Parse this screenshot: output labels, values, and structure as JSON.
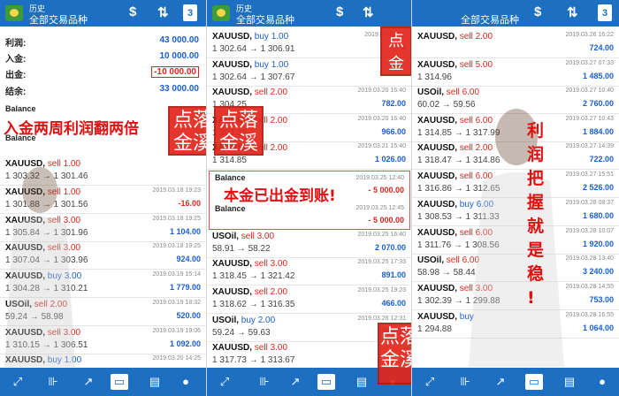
{
  "header": {
    "subtitle": "历史",
    "title": "全部交易品种",
    "calendar_day": "3"
  },
  "summary": [
    {
      "label": "利润:",
      "value": "43 000.00",
      "neg": false
    },
    {
      "label": "入金:",
      "value": "10 000.00",
      "neg": false
    },
    {
      "label": "出金:",
      "value": "-10 000.00",
      "neg": true
    },
    {
      "label": "结余:",
      "value": "33 000.00",
      "neg": false
    }
  ],
  "overlays": {
    "headline": "入金两周利润翻两倍",
    "principal": "本金已出金到账!",
    "side_text": [
      "利",
      "润",
      "把",
      "握",
      "就",
      "是",
      "稳",
      "!"
    ],
    "seal": [
      "点",
      "落",
      "金",
      "溪"
    ]
  },
  "panel1": {
    "balance1": "Balance",
    "balance2": "Balance",
    "trades": [
      {
        "symbol": "XAUUSD,",
        "side": "sell",
        "lot": "1.00",
        "price": "1 303.32 → 1 301.46",
        "date": "",
        "pl": ""
      },
      {
        "symbol": "XAUUSD,",
        "side": "sell",
        "lot": "1.00",
        "price": "1 301.88 → 1 301.56",
        "date": "2019.03.18 19:23",
        "pl": "-16.00"
      },
      {
        "symbol": "XAUUSD,",
        "side": "sell",
        "lot": "3.00",
        "price": "1 305.84 → 1 301.96",
        "date": "2019.03.18 19:25",
        "pl": "1 104.00"
      },
      {
        "symbol": "XAUUSD,",
        "side": "sell",
        "lot": "3.00",
        "price": "1 307.04 → 1 303.96",
        "date": "2019.03.18 19:25",
        "pl": "924.00"
      },
      {
        "symbol": "XAUUSD,",
        "side": "buy",
        "lot": "3.00",
        "price": "1 304.28 → 1 310.21",
        "date": "2019.03.19 15:14",
        "pl": "1 779.00"
      },
      {
        "symbol": "USOil,",
        "side": "sell",
        "lot": "2.00",
        "price": "59.24 → 58.98",
        "date": "2019.03.19 18:32",
        "pl": "520.00"
      },
      {
        "symbol": "XAUUSD,",
        "side": "sell",
        "lot": "3.00",
        "price": "1 310.15 → 1 306.51",
        "date": "2019.03.19 19:06",
        "pl": "1 092.00"
      },
      {
        "symbol": "XAUUSD,",
        "side": "buy",
        "lot": "1.00",
        "price": "",
        "date": "2019.03.20 14:25",
        "pl": ""
      }
    ]
  },
  "panel2": {
    "callout_balance1": "Balance",
    "callout_balance2": "Balance",
    "callout_date1": "2019.03.25 12:40",
    "callout_pl1": "- 5 000.00",
    "callout_date2": "2019.03.25 12:45",
    "callout_pl2": "- 5 000.00",
    "trades": [
      {
        "symbol": "XAUUSD,",
        "side": "buy",
        "lot": "1.00",
        "price": "1 302.64 → 1 306.91",
        "date": "2019.03.20 16:",
        "pl": "4"
      },
      {
        "symbol": "XAUUSD,",
        "side": "buy",
        "lot": "1.00",
        "price": "1 302.64 → 1 307.67",
        "date": "",
        "pl": ""
      },
      {
        "symbol": "XAUUSD,",
        "side": "sell",
        "lot": "2.00",
        "price": "1 304.25",
        "date": "2019.03.20 16:40",
        "pl": "782.00"
      },
      {
        "symbol": "XAUUSD,",
        "side": "sell",
        "lot": "2.00",
        "price": "1 304.35",
        "date": "2019.03.20 16:40",
        "pl": "966.00"
      },
      {
        "symbol": "XAUUSD,",
        "side": "sell",
        "lot": "2.00",
        "price": "1 314.85",
        "date": "2019.03.21 15:40",
        "pl": "1 026.00"
      },
      {
        "symbol": "USOil,",
        "side": "sell",
        "lot": "3.00",
        "price": "58.91 → 58.22",
        "date": "2019.03.25 16:40",
        "pl": "2 070.00"
      },
      {
        "symbol": "XAUUSD,",
        "side": "sell",
        "lot": "3.00",
        "price": "1 318.45 → 1 321.42",
        "date": "2019.03.25 17:33",
        "pl": "891.00"
      },
      {
        "symbol": "XAUUSD,",
        "side": "sell",
        "lot": "2.00",
        "price": "1 318.62 → 1 316.35",
        "date": "2019.03.25 19:23",
        "pl": "466.00"
      },
      {
        "symbol": "USOil,",
        "side": "buy",
        "lot": "2.00",
        "price": "59.24 → 59.63",
        "date": "2019.03.26 12:31",
        "pl": "780.00"
      },
      {
        "symbol": "XAUUSD,",
        "side": "sell",
        "lot": "3.00",
        "price": "1 317.73 → 1 313.67",
        "date": "",
        "pl": ""
      }
    ]
  },
  "panel3": {
    "trades": [
      {
        "symbol": "XAUUSD,",
        "side": "sell",
        "lot": "2.00",
        "price": "",
        "date": "2019.03.26 16:22",
        "pl": "724.00"
      },
      {
        "symbol": "XAUUSD,",
        "side": "sell",
        "lot": "5.00",
        "price": "1 314.96",
        "date": "2019.03.27 07:33",
        "pl": "1 485.00"
      },
      {
        "symbol": "USOil,",
        "side": "sell",
        "lot": "6.00",
        "price": "60.02 → 59.56",
        "date": "2019.03.27 10:40",
        "pl": "2 760.00"
      },
      {
        "symbol": "XAUUSD,",
        "side": "sell",
        "lot": "6.00",
        "price": "1 314.85 → 1 317.99",
        "date": "2019.03.27 10:43",
        "pl": "1 884.00"
      },
      {
        "symbol": "XAUUSD,",
        "side": "sell",
        "lot": "2.00",
        "price": "1 318.47 → 1 314.86",
        "date": "2019.03.27 14:39",
        "pl": "722.00"
      },
      {
        "symbol": "XAUUSD,",
        "side": "sell",
        "lot": "6.00",
        "price": "1 316.86 → 1 312.65",
        "date": "2019.03.27 15:51",
        "pl": "2 526.00"
      },
      {
        "symbol": "XAUUSD,",
        "side": "buy",
        "lot": "6.00",
        "price": "1 308.53 → 1 311.33",
        "date": "2019.03.28 08:37",
        "pl": "1 680.00"
      },
      {
        "symbol": "XAUUSD,",
        "side": "sell",
        "lot": "6.00",
        "price": "1 311.76 → 1 308.56",
        "date": "2019.03.28 10:07",
        "pl": "1 920.00"
      },
      {
        "symbol": "USOil,",
        "side": "sell",
        "lot": "6.00",
        "price": "58.98 → 58.44",
        "date": "2019.03.28 13:40",
        "pl": "3 240.00"
      },
      {
        "symbol": "XAUUSD,",
        "side": "sell",
        "lot": "3.00",
        "price": "1 302.39 → 1 299.88",
        "date": "2019.03.28 14:55",
        "pl": "753.00"
      },
      {
        "symbol": "XAUUSD,",
        "side": "buy",
        "lot": "",
        "price": "1 294.88",
        "date": "2019.03.28 16:55",
        "pl": "1 064.00"
      }
    ]
  },
  "colors": {
    "topbar": "#1d6fc1",
    "buy": "#1a5fd0",
    "sell": "#d7281e",
    "seal": "#e3261c"
  },
  "icons": [
    "chart-icon",
    "candles-icon",
    "trend-icon",
    "inbox-icon",
    "news-icon",
    "chat-icon"
  ]
}
